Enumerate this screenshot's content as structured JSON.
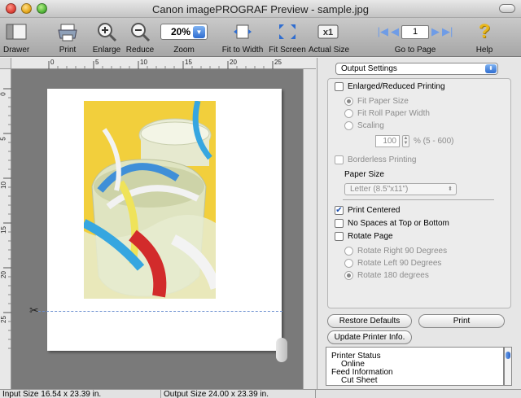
{
  "window": {
    "title": "Canon imagePROGRAF Preview - sample.jpg"
  },
  "toolbar": {
    "drawer": "Drawer",
    "print": "Print",
    "enlarge": "Enlarge",
    "reduce": "Reduce",
    "zoom_label": "Zoom",
    "zoom_value": "20%",
    "fit_to_width": "Fit to Width",
    "fit_screen": "Fit Screen",
    "actual_size": "Actual Size",
    "go_to_page": "Go to Page",
    "page_value": "1",
    "help": "Help"
  },
  "ruler": {
    "top_ticks": [
      "0",
      "5",
      "10",
      "15",
      "20",
      "25"
    ],
    "left_ticks": [
      "0",
      "5",
      "10",
      "15",
      "20",
      "25"
    ]
  },
  "status": {
    "input_size": "Input Size 16.54 x 23.39 in.",
    "output_size": "Output Size 24.00 x 23.39 in."
  },
  "panel": {
    "settings_select": "Output Settings",
    "enlarged_reduced": "Enlarged/Reduced Printing",
    "fit_paper_size": "Fit Paper Size",
    "fit_roll_paper_width": "Fit Roll Paper Width",
    "scaling": "Scaling",
    "scaling_value": "100",
    "scaling_range": "% (5 - 600)",
    "borderless": "Borderless Printing",
    "paper_size_label": "Paper Size",
    "paper_size_value": "Letter (8.5\"x11\")",
    "print_centered": "Print Centered",
    "no_spaces": "No Spaces at Top or Bottom",
    "rotate_page": "Rotate Page",
    "rotate_right_90": "Rotate Right 90 Degrees",
    "rotate_left_90": "Rotate Left 90 Degrees",
    "rotate_180": "Rotate 180 degrees",
    "restore_defaults": "Restore Defaults",
    "print_button": "Print",
    "update_printer_info": "Update Printer Info.",
    "info_lines": [
      "Printer Status",
      "Online",
      "Feed Information",
      "Cut Sheet"
    ]
  },
  "colors": {
    "accent_blue": "#2f6dd0",
    "photo_yellow": "#f4d23a"
  }
}
